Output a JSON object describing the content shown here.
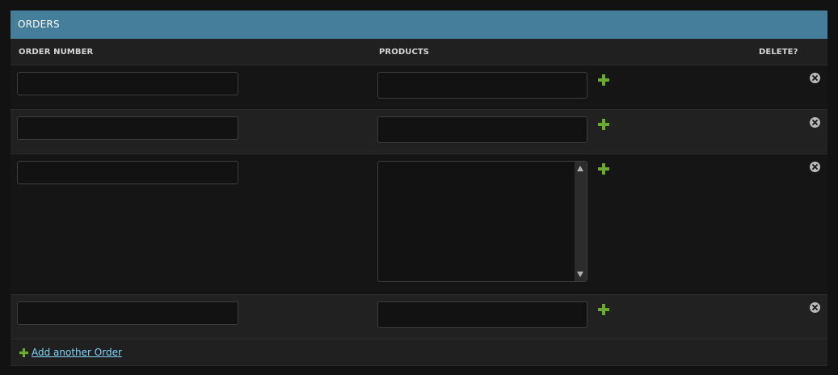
{
  "caption": "ORDERS",
  "columns": {
    "order_number": "ORDER NUMBER",
    "products": "PRODUCTS",
    "delete": "DELETE?"
  },
  "rows": [
    {
      "order_number": "",
      "products": ""
    },
    {
      "order_number": "",
      "products": ""
    },
    {
      "order_number": "",
      "products": []
    },
    {
      "order_number": "",
      "products": ""
    }
  ],
  "add_another_label": "Add another Order",
  "icons": {
    "add": "plus-icon",
    "delete": "delete-x-icon",
    "scroll_up": "scroll-up-arrow-icon",
    "scroll_down": "scroll-down-arrow-icon"
  },
  "colors": {
    "caption_bg": "#447e9b",
    "add_green": "#6aaa2e",
    "link": "#81d4fa",
    "delete_icon": "#b9b9b9"
  }
}
